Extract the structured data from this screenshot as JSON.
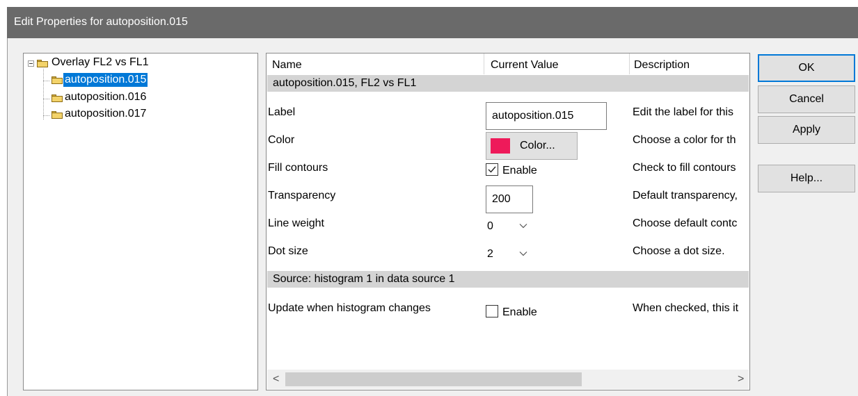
{
  "window": {
    "title": "Edit Properties for autoposition.015"
  },
  "tree": {
    "root": {
      "label": "Overlay FL2 vs FL1",
      "icon": "folder-icon",
      "expanded": true
    },
    "children": [
      {
        "label": "autoposition.015",
        "selected": true
      },
      {
        "label": "autoposition.016",
        "selected": false
      },
      {
        "label": "autoposition.017",
        "selected": false
      }
    ]
  },
  "grid": {
    "columns": [
      "Name",
      "Current Value",
      "Description"
    ],
    "section1": "autoposition.015, FL2 vs FL1",
    "rows": {
      "label": {
        "name": "Label",
        "value": "autoposition.015",
        "description": "Edit the label for this"
      },
      "color": {
        "name": "Color",
        "button": "Color...",
        "swatch": "#ee1a5a",
        "description": "Choose a color for th"
      },
      "fill": {
        "name": "Fill contours",
        "checkbox_label": "Enable",
        "checked": true,
        "description": "Check to fill contours"
      },
      "transparency": {
        "name": "Transparency",
        "value": "200",
        "description": "Default transparency,"
      },
      "line_weight": {
        "name": "Line weight",
        "value": "0",
        "description": "Choose default contc"
      },
      "dot_size": {
        "name": "Dot size",
        "value": "2",
        "description": "Choose a dot size."
      }
    },
    "section2": "Source: histogram 1 in data source 1",
    "update": {
      "name": "Update when histogram changes",
      "checkbox_label": "Enable",
      "checked": false,
      "description": "When checked, this it"
    }
  },
  "scrollbar": {
    "left": "<",
    "right": ">"
  },
  "buttons": {
    "ok": "OK",
    "cancel": "Cancel",
    "apply": "Apply",
    "help": "Help..."
  }
}
